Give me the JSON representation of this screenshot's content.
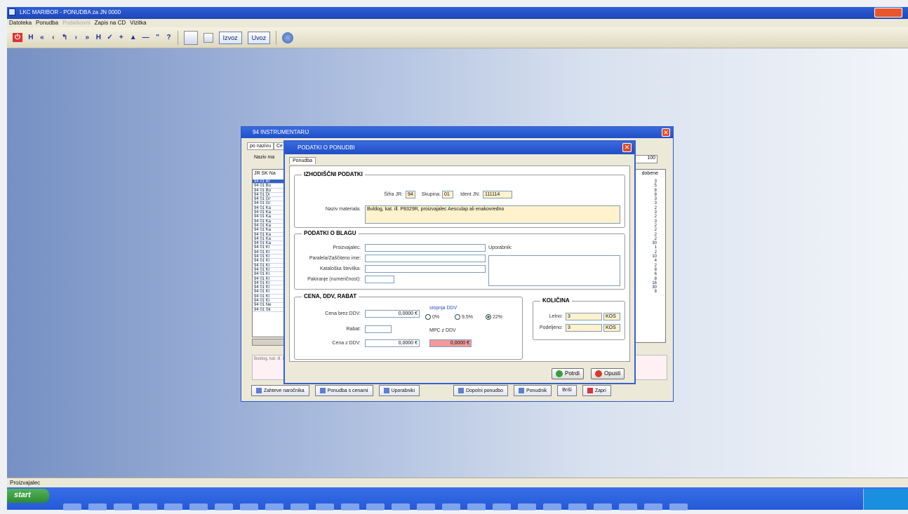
{
  "app": {
    "title": "LKC MARIBOR - PONUDBA za JN 0000",
    "menu": [
      "Datoteka",
      "Ponudba",
      "Podatkovni",
      "Zapis na CD",
      "Vizitka"
    ],
    "toolbar_symbols": [
      "⏻",
      "H",
      "«",
      "‹",
      "↰",
      "›",
      "»",
      "H",
      "✓",
      "+",
      "▲",
      "—",
      "\"",
      "?"
    ],
    "export_label": "Izvoz",
    "import_label": "Uvoz",
    "status_text": "Proizvajalec"
  },
  "taskbar": {
    "start_label": "start"
  },
  "list_window": {
    "title": "94 INSTRUMENTARIJ",
    "tabs": [
      "po nazivu",
      "Ce"
    ],
    "search_label": "Naziv ma",
    "grid_header": "JR SK Na",
    "rows": [
      "94 01 Br",
      "94 01 Bu",
      "94 01 Bu",
      "94 01 Di",
      "94 01 Gr",
      "94 01 Gr",
      "94 01 Ka",
      "94 01 Ka",
      "94 01 Ka",
      "94 01 Ka",
      "94 01 Ka",
      "94 01 Ka",
      "94 01 Ka",
      "94 01 Ka",
      "94 01 Ka",
      "94 01 Kl",
      "94 01 Kl",
      "94 01 Kl",
      "94 01 Kl",
      "94 01 Kl",
      "94 01 Kl",
      "94 01 Kl",
      "94 01 Kl",
      "94 01 Kl",
      "94 01 Kl",
      "94 01 Kl",
      "94 01 Kl",
      "94 01 Kl",
      "94 01 Ne",
      "94 01 Sk"
    ],
    "right_search_value": "100",
    "right_header": "dobene",
    "right_values": [
      "3",
      "5",
      "8",
      "8",
      "3",
      "3",
      "2",
      "3",
      "2",
      "3",
      "2",
      "2",
      "2",
      "2",
      "30",
      "1",
      "2",
      "10",
      "4",
      "2",
      "8",
      "6",
      "8",
      "16",
      "30",
      "8"
    ],
    "note": "Buldog, kat. ill. P",
    "buttons": [
      "Zahteve naročnika",
      "Ponudba s cenami",
      "Uporabniki",
      "Dopolni ponudbo",
      "Ponudnik",
      "Briši",
      "Zapri"
    ]
  },
  "offer_dialog": {
    "title": "PODATKI O PONUDBI",
    "tab": "Ponudba",
    "source_group": "IZHODIŠČNI PODATKI",
    "jr_label": "Šifra JR:",
    "jr_value": "94",
    "group_label": "Skupina:",
    "group_value": "01",
    "ident_label": "Ident JN:",
    "ident_value": "111114",
    "material_label": "Naziv materiala:",
    "material_value": "Buldog, kat. ill. P8329R, proizvajalec Aesculap ali enakovredno",
    "goods_group": "PODATKI O BLAGU",
    "manufacturer_label": "Proizvajalec:",
    "brand_label": "Paralela/Zaščiteno ime:",
    "catalog_label": "Kataloška številka:",
    "packaging_label": "Pakiranje (numeričnost):",
    "users_label": "Uporabnik:",
    "price_group": "CENA, DDV, RABAT",
    "price_no_vat_label": "Cena brez DDV:",
    "price_no_vat_value": "0,0000 €",
    "vat_rate_label": "stopnja DDV",
    "vat_options": [
      "0%",
      "9,5%",
      "22%"
    ],
    "vat_selected": "22%",
    "discount_label": "Rabat:",
    "discount_value": "",
    "mpc_label": "MPC z DDV",
    "price_with_vat_label": "Cena z DDV:",
    "price_with_vat_value": "0,0000 €",
    "mpc_value": "0,0000 €",
    "qty_group": "KOLIČINA",
    "annual_label": "Letno:",
    "annual_value": "3",
    "annual_unit": "KOS",
    "awarded_label": "Podeljeno:",
    "awarded_value": "3",
    "awarded_unit": "KOS",
    "save_label": "Potrdi",
    "cancel_label": "Opusti",
    "accent_color": "#3761cf"
  }
}
